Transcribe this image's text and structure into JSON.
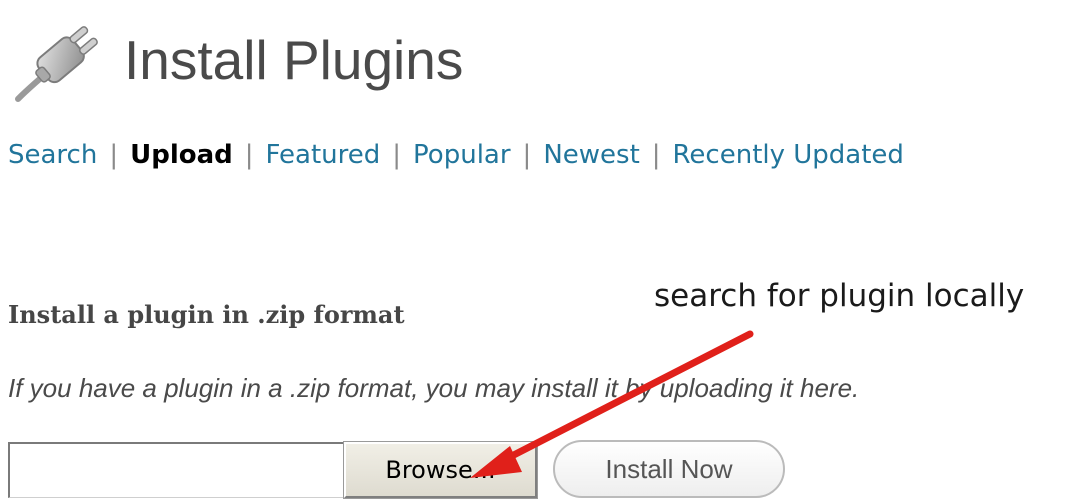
{
  "header": {
    "icon": "plugin-plug-icon",
    "title": "Install Plugins"
  },
  "tabs": [
    {
      "label": "Search",
      "current": false
    },
    {
      "label": "Upload",
      "current": true
    },
    {
      "label": "Featured",
      "current": false
    },
    {
      "label": "Popular",
      "current": false
    },
    {
      "label": "Newest",
      "current": false
    },
    {
      "label": "Recently Updated",
      "current": false
    }
  ],
  "tab_separator": "|",
  "upload": {
    "heading": "Install a plugin in .zip format",
    "description": "If you have a plugin in a .zip format, you may install it by uploading it here.",
    "file_input_value": "",
    "browse_label": "Browse...",
    "install_label": "Install Now"
  },
  "annotation": {
    "text": "search for plugin locally",
    "arrow_icon": "red-arrow-icon",
    "arrow_color": "#e0201a"
  },
  "colors": {
    "link": "#21759b",
    "current_tab": "#000000",
    "title": "#4a4a4a"
  }
}
